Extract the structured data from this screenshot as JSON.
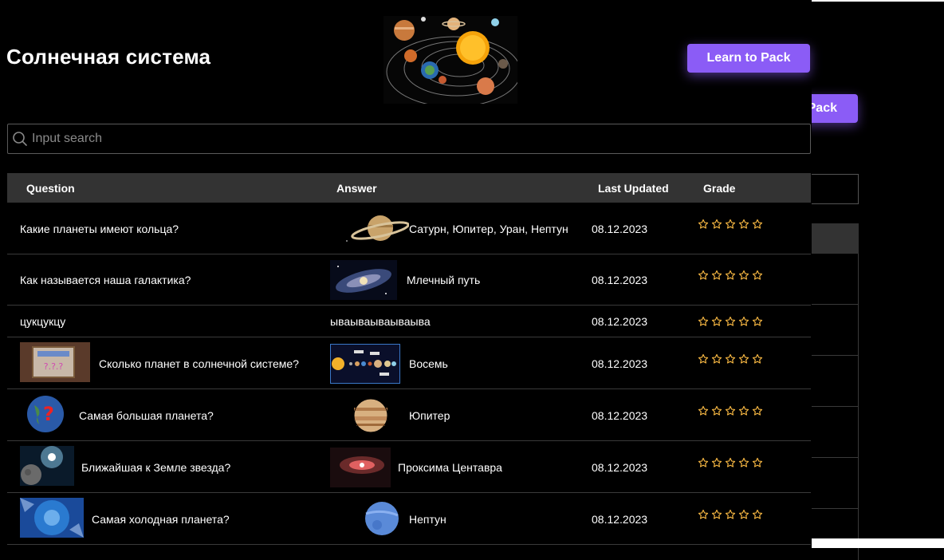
{
  "page": {
    "title": "Солнечная система",
    "learn_button_label": "Learn to Pack",
    "ghost_button_fragment": "Pack"
  },
  "search": {
    "placeholder": "Input search",
    "value": ""
  },
  "table": {
    "columns": {
      "question": "Question",
      "answer": "Answer",
      "last_updated": "Last Updated",
      "grade": "Grade"
    },
    "rows": [
      {
        "question": "Какие планеты имеют кольца?",
        "question_image": null,
        "answer": "Сатурн, Юпитер, Уран, Нептун",
        "answer_image": "saturn",
        "updated": "08.12.2023",
        "grade": 0
      },
      {
        "question": "Как называется наша галактика?",
        "question_image": null,
        "answer": "Млечный путь",
        "answer_image": "galaxy",
        "updated": "08.12.2023",
        "grade": 0
      },
      {
        "question": "цукцукцу",
        "question_image": null,
        "answer": "ываываываываыва",
        "answer_image": null,
        "updated": "08.12.2023",
        "grade": 0
      },
      {
        "question": "Сколько планет в солнечной системе?",
        "question_image": "question-card",
        "answer": "Восемь",
        "answer_image": "solar-system-chart",
        "updated": "08.12.2023",
        "grade": 0
      },
      {
        "question": "Самая большая планета?",
        "question_image": "earth-question",
        "answer": "Юпитер",
        "answer_image": "jupiter",
        "updated": "08.12.2023",
        "grade": 0
      },
      {
        "question": "Ближайшая к Земле звезда?",
        "question_image": "space-star",
        "answer": "Проксима Центавра",
        "answer_image": "proxima",
        "updated": "08.12.2023",
        "grade": 0
      },
      {
        "question": "Самая холодная планета?",
        "question_image": "ice",
        "answer": "Нептун",
        "answer_image": "neptune",
        "updated": "08.12.2023",
        "grade": 0
      }
    ]
  },
  "colors": {
    "accent": "#8b5cf6",
    "star": "#f5b642",
    "header_bg": "#333333"
  },
  "icons": {
    "search": "search-icon",
    "star": "star-outline-icon"
  }
}
